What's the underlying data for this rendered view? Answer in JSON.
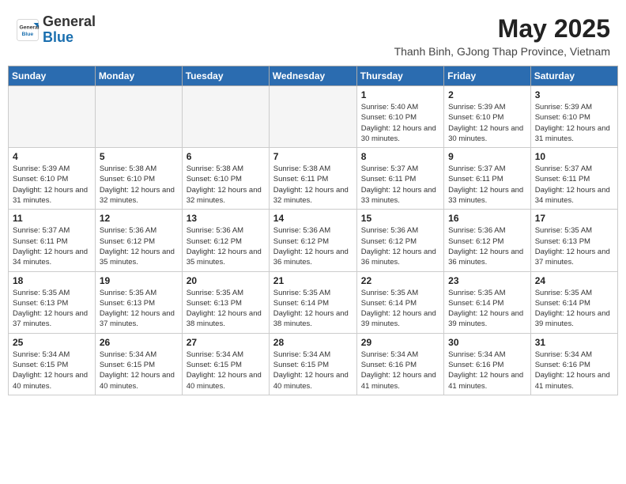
{
  "header": {
    "logo_general": "General",
    "logo_blue": "Blue",
    "month_year": "May 2025",
    "location": "Thanh Binh, GJong Thap Province, Vietnam"
  },
  "days_of_week": [
    "Sunday",
    "Monday",
    "Tuesday",
    "Wednesday",
    "Thursday",
    "Friday",
    "Saturday"
  ],
  "weeks": [
    {
      "days": [
        {
          "num": "",
          "info": ""
        },
        {
          "num": "",
          "info": ""
        },
        {
          "num": "",
          "info": ""
        },
        {
          "num": "",
          "info": ""
        },
        {
          "num": "1",
          "info": "Sunrise: 5:40 AM\nSunset: 6:10 PM\nDaylight: 12 hours and 30 minutes."
        },
        {
          "num": "2",
          "info": "Sunrise: 5:39 AM\nSunset: 6:10 PM\nDaylight: 12 hours and 30 minutes."
        },
        {
          "num": "3",
          "info": "Sunrise: 5:39 AM\nSunset: 6:10 PM\nDaylight: 12 hours and 31 minutes."
        }
      ]
    },
    {
      "days": [
        {
          "num": "4",
          "info": "Sunrise: 5:39 AM\nSunset: 6:10 PM\nDaylight: 12 hours and 31 minutes."
        },
        {
          "num": "5",
          "info": "Sunrise: 5:38 AM\nSunset: 6:10 PM\nDaylight: 12 hours and 32 minutes."
        },
        {
          "num": "6",
          "info": "Sunrise: 5:38 AM\nSunset: 6:10 PM\nDaylight: 12 hours and 32 minutes."
        },
        {
          "num": "7",
          "info": "Sunrise: 5:38 AM\nSunset: 6:11 PM\nDaylight: 12 hours and 32 minutes."
        },
        {
          "num": "8",
          "info": "Sunrise: 5:37 AM\nSunset: 6:11 PM\nDaylight: 12 hours and 33 minutes."
        },
        {
          "num": "9",
          "info": "Sunrise: 5:37 AM\nSunset: 6:11 PM\nDaylight: 12 hours and 33 minutes."
        },
        {
          "num": "10",
          "info": "Sunrise: 5:37 AM\nSunset: 6:11 PM\nDaylight: 12 hours and 34 minutes."
        }
      ]
    },
    {
      "days": [
        {
          "num": "11",
          "info": "Sunrise: 5:37 AM\nSunset: 6:11 PM\nDaylight: 12 hours and 34 minutes."
        },
        {
          "num": "12",
          "info": "Sunrise: 5:36 AM\nSunset: 6:12 PM\nDaylight: 12 hours and 35 minutes."
        },
        {
          "num": "13",
          "info": "Sunrise: 5:36 AM\nSunset: 6:12 PM\nDaylight: 12 hours and 35 minutes."
        },
        {
          "num": "14",
          "info": "Sunrise: 5:36 AM\nSunset: 6:12 PM\nDaylight: 12 hours and 36 minutes."
        },
        {
          "num": "15",
          "info": "Sunrise: 5:36 AM\nSunset: 6:12 PM\nDaylight: 12 hours and 36 minutes."
        },
        {
          "num": "16",
          "info": "Sunrise: 5:36 AM\nSunset: 6:12 PM\nDaylight: 12 hours and 36 minutes."
        },
        {
          "num": "17",
          "info": "Sunrise: 5:35 AM\nSunset: 6:13 PM\nDaylight: 12 hours and 37 minutes."
        }
      ]
    },
    {
      "days": [
        {
          "num": "18",
          "info": "Sunrise: 5:35 AM\nSunset: 6:13 PM\nDaylight: 12 hours and 37 minutes."
        },
        {
          "num": "19",
          "info": "Sunrise: 5:35 AM\nSunset: 6:13 PM\nDaylight: 12 hours and 37 minutes."
        },
        {
          "num": "20",
          "info": "Sunrise: 5:35 AM\nSunset: 6:13 PM\nDaylight: 12 hours and 38 minutes."
        },
        {
          "num": "21",
          "info": "Sunrise: 5:35 AM\nSunset: 6:14 PM\nDaylight: 12 hours and 38 minutes."
        },
        {
          "num": "22",
          "info": "Sunrise: 5:35 AM\nSunset: 6:14 PM\nDaylight: 12 hours and 39 minutes."
        },
        {
          "num": "23",
          "info": "Sunrise: 5:35 AM\nSunset: 6:14 PM\nDaylight: 12 hours and 39 minutes."
        },
        {
          "num": "24",
          "info": "Sunrise: 5:35 AM\nSunset: 6:14 PM\nDaylight: 12 hours and 39 minutes."
        }
      ]
    },
    {
      "days": [
        {
          "num": "25",
          "info": "Sunrise: 5:34 AM\nSunset: 6:15 PM\nDaylight: 12 hours and 40 minutes."
        },
        {
          "num": "26",
          "info": "Sunrise: 5:34 AM\nSunset: 6:15 PM\nDaylight: 12 hours and 40 minutes."
        },
        {
          "num": "27",
          "info": "Sunrise: 5:34 AM\nSunset: 6:15 PM\nDaylight: 12 hours and 40 minutes."
        },
        {
          "num": "28",
          "info": "Sunrise: 5:34 AM\nSunset: 6:15 PM\nDaylight: 12 hours and 40 minutes."
        },
        {
          "num": "29",
          "info": "Sunrise: 5:34 AM\nSunset: 6:16 PM\nDaylight: 12 hours and 41 minutes."
        },
        {
          "num": "30",
          "info": "Sunrise: 5:34 AM\nSunset: 6:16 PM\nDaylight: 12 hours and 41 minutes."
        },
        {
          "num": "31",
          "info": "Sunrise: 5:34 AM\nSunset: 6:16 PM\nDaylight: 12 hours and 41 minutes."
        }
      ]
    }
  ]
}
